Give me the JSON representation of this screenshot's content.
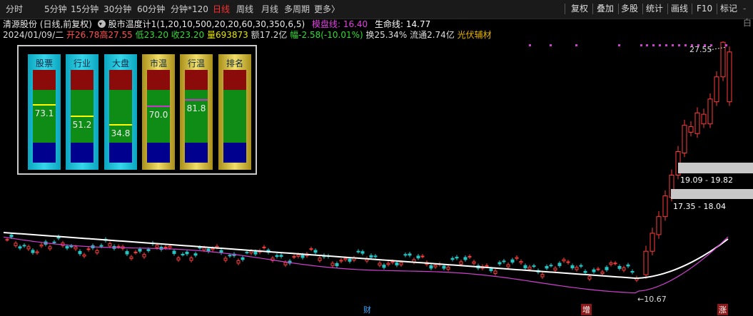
{
  "toolbar": {
    "periods": [
      "分时",
      "5分钟",
      "15分钟",
      "30分钟",
      "60分钟",
      "分钟*120",
      "日线",
      "周线",
      "月线",
      "多周期",
      "更多"
    ],
    "more_arrow": "〉",
    "active_index": 6,
    "right_items": [
      "复权",
      "叠加",
      "多股",
      "统计",
      "画线",
      "F10",
      "标记"
    ],
    "right_tail": "-白"
  },
  "info1": {
    "stock": "清源股份 (日线,前复权)",
    "indicator": "股市温度计1(1,20,10,500,20,20,60,30,350,6,5)",
    "cost_line_label": "模盘线: 16.40",
    "life_line_label": "生命线: 14.77"
  },
  "info2": {
    "date": "2024/01/09/二",
    "open": "开26.78",
    "high": "高27.55",
    "low": "低23.20",
    "close": "收23.20",
    "volume": "量693873",
    "amount": "额17.2亿",
    "change": "幅-2.58(-10.01%)",
    "turnover": "换25.34%",
    "float": "流通2.74亿",
    "concept": "光伏辅材"
  },
  "gauges": [
    {
      "title": "股票",
      "value": "73.1",
      "level": 73.1,
      "style": "cyan",
      "mark_color": "#ffff00"
    },
    {
      "title": "行业",
      "value": "51.2",
      "level": 51.2,
      "style": "cyan",
      "mark_color": "#ffff00"
    },
    {
      "title": "大盘",
      "value": "34.8",
      "level": 34.8,
      "style": "cyan",
      "mark_color": "#ffff00"
    },
    {
      "title": "市温",
      "value": "70.0",
      "level": 70.0,
      "style": "gold",
      "mark_color": "#cc33cc"
    },
    {
      "title": "行温",
      "value": "81.8",
      "level": 81.8,
      "style": "gold",
      "mark_color": "#cc33cc"
    },
    {
      "title": "排名",
      "value": "",
      "level": null,
      "style": "gold",
      "mark_color": ""
    }
  ],
  "price_labels": {
    "high": "27.55",
    "low": "10.67"
  },
  "bands": [
    {
      "label": "19.09 - 19.82"
    },
    {
      "label": "17.35 - 18.04"
    }
  ],
  "bottom_badges": [
    {
      "text": "财",
      "color": "#3da6ff"
    },
    {
      "text": "增",
      "color": "#ffffff"
    },
    {
      "text": "涨",
      "color": "#ffffff"
    }
  ],
  "colors": {
    "up": "#ff3c3c",
    "down": "#27c4c4",
    "ma_white": "#ffffff",
    "ma_purple": "#d040d0"
  }
}
